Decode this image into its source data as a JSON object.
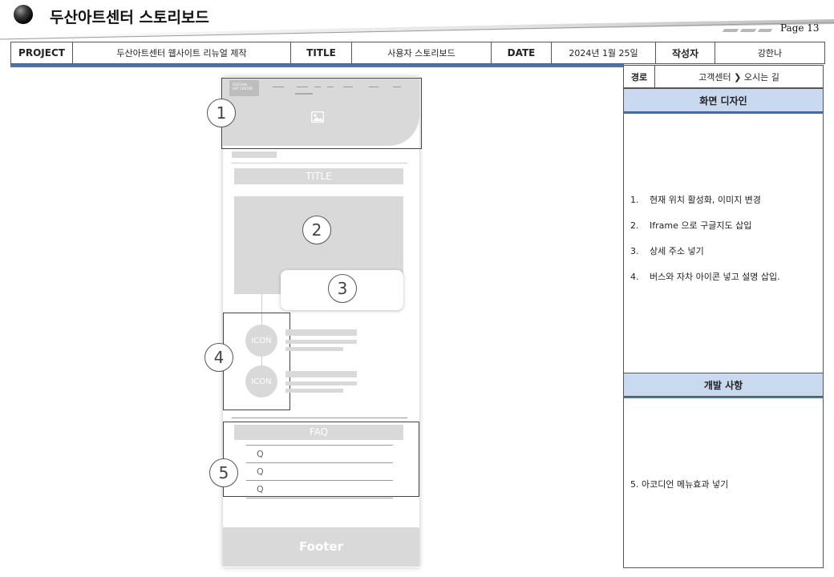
{
  "header": {
    "title": "두산아트센터 스토리보드",
    "page": "Page 13"
  },
  "info": {
    "project_label": "PROJECT",
    "project_value": "두산아트센터 웹사이트 리뉴얼 제작",
    "title_label": "TITLE",
    "title_value": "사용자 스토리보드",
    "date_label": "DATE",
    "date_value": "2024년 1월 25일",
    "author_label": "작성자",
    "author_value": "강한나"
  },
  "panel": {
    "path_label": "경로",
    "path_value": "고객센터 ❯ 오시는 길",
    "design_heading": "화면 디자인",
    "design_items": [
      {
        "num": "1.",
        "text": "현재 위치 활성화, 이미지 변경"
      },
      {
        "num": "2.",
        "text": "Iframe 으로 구글지도 삽입"
      },
      {
        "num": "3.",
        "text": "상세 주소 넣기"
      },
      {
        "num": "4.",
        "text": "버스와 자차 아이콘 넣고 설명 삽입."
      }
    ],
    "dev_heading": "개발 사항",
    "dev_note": "5. 아코디언 메뉴효과 넣기"
  },
  "wireframe": {
    "logo_line1": "DOOSAN",
    "logo_line2": "ART CENTER",
    "title_box": "TITLE",
    "icon_label": "ICON",
    "faq_label": "FAQ",
    "q_label": "Q",
    "footer_label": "Footer",
    "markers": [
      "1",
      "2",
      "3",
      "4",
      "5"
    ]
  }
}
